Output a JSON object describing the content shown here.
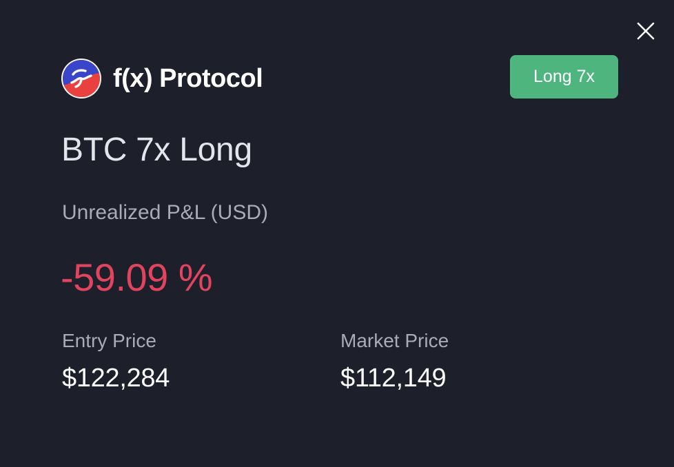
{
  "close": {
    "icon": "close-icon"
  },
  "brand": {
    "logo_icon": "fx-protocol-logo-icon",
    "name": "f(x) Protocol"
  },
  "badge": {
    "label": "Long 7x",
    "color": "#4fb57f"
  },
  "position": {
    "title": "BTC 7x Long",
    "pnl_label": "Unrealized P&L (USD)",
    "pnl_value": "-59.09 %",
    "pnl_color": "#e0445f"
  },
  "stats": {
    "entry": {
      "label": "Entry Price",
      "value": "$122,284"
    },
    "market": {
      "label": "Market Price",
      "value": "$112,149"
    }
  },
  "colors": {
    "background": "#1d1f2b",
    "muted_text": "#a9abb8"
  }
}
